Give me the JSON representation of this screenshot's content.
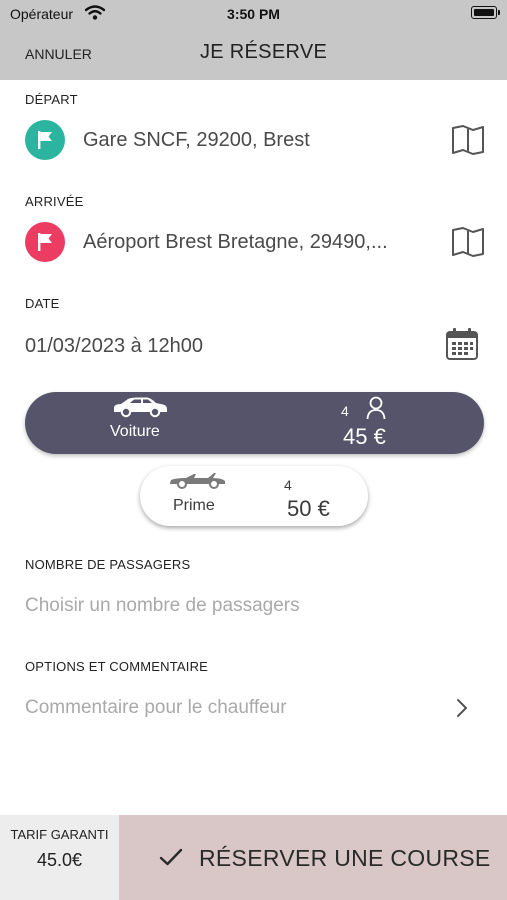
{
  "status_bar": {
    "carrier": "Opérateur",
    "time": "3:50 PM"
  },
  "nav": {
    "cancel_label": "ANNULER",
    "title": "JE RÉSERVE"
  },
  "departure": {
    "label": "DÉPART",
    "address": "Gare SNCF, 29200, Brest",
    "flag_color": "#2bb5a0",
    "icon": "flag-icon",
    "action_icon": "book-icon"
  },
  "arrival": {
    "label": "ARRIVÉE",
    "address": "Aéroport Brest Bretagne, 29490,...",
    "flag_color": "#ec3c62",
    "icon": "flag-icon",
    "action_icon": "book-icon"
  },
  "date": {
    "label": "DATE",
    "value": "01/03/2023 à 12h00",
    "icon": "calendar-icon"
  },
  "vehicles": [
    {
      "name": "Voiture",
      "seats": "4",
      "price": "45 €",
      "selected": true,
      "icon": "car-icon"
    },
    {
      "name": "Prime",
      "seats": "4",
      "price": "50 €",
      "selected": false,
      "icon": "convertible-car-icon"
    }
  ],
  "passengers": {
    "label": "NOMBRE DE PASSAGERS",
    "placeholder": "Choisir un nombre de passagers"
  },
  "options": {
    "label": "OPTIONS ET COMMENTAIRE",
    "placeholder": "Commentaire pour le chauffeur",
    "icon": "chevron-right-icon"
  },
  "footer": {
    "tarif_label": "TARIF GARANTI",
    "tarif_value": "45.0€",
    "cta_label": "RÉSERVER UNE COURSE",
    "cta_icon": "checkmark-icon"
  },
  "colors": {
    "header_bg": "#c7c7c7",
    "selected_vehicle_bg": "#56546a",
    "cta_bg": "#d9c6c6",
    "tarif_bg": "#ededed",
    "placeholder_text": "#a9a9a9"
  }
}
